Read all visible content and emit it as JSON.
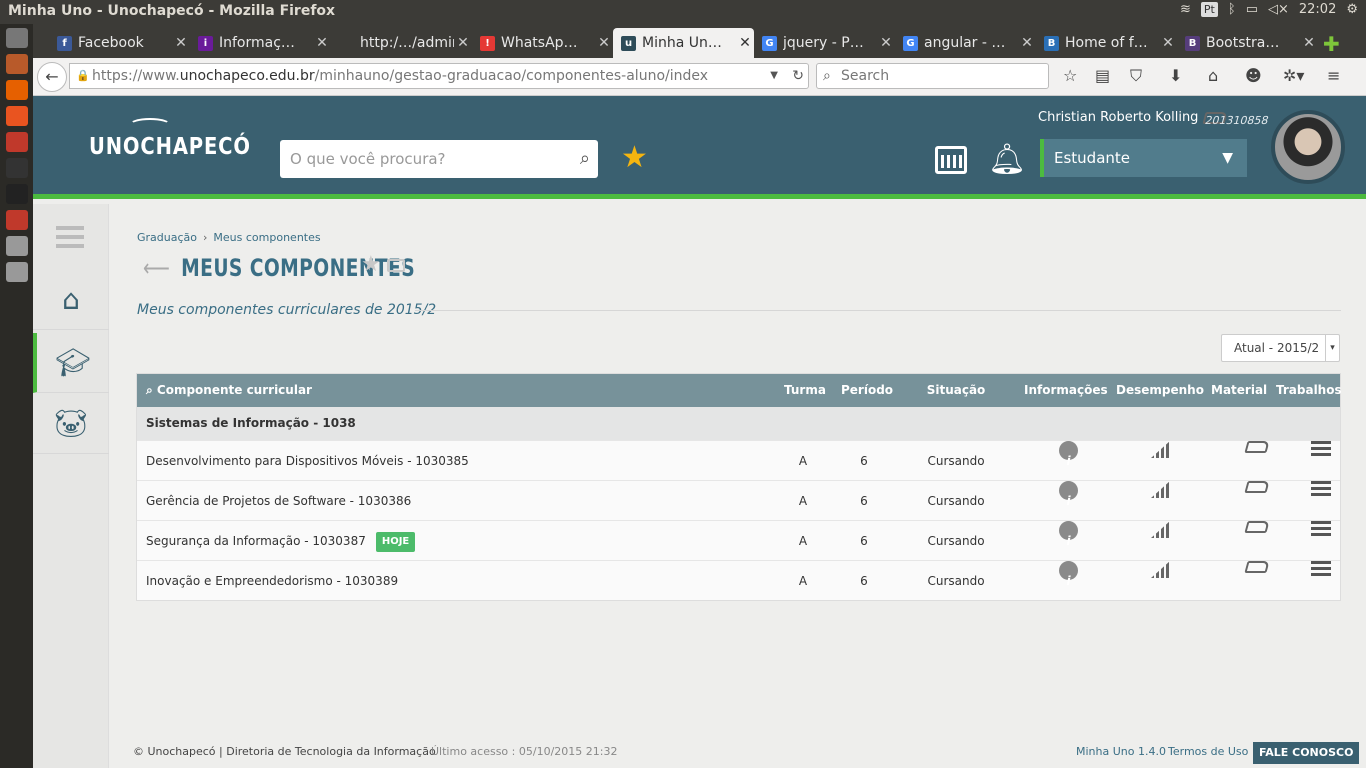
{
  "window": {
    "title": "Minha Uno - Unochapecó - Mozilla Firefox",
    "lang": "Pt",
    "time": "22:02"
  },
  "tabs": [
    {
      "label": "Facebook",
      "color": "#3b5998",
      "glyph": "f"
    },
    {
      "label": "Informaç…",
      "color": "#6a1b9a",
      "glyph": "i"
    },
    {
      "label": "http:/…/admin",
      "color": "",
      "glyph": ""
    },
    {
      "label": "WhatsAp…",
      "color": "#e53935",
      "glyph": "!"
    },
    {
      "label": "Minha Un…",
      "color": "#2e4c59",
      "glyph": "u"
    },
    {
      "label": "jquery - P…",
      "color": "#4285f4",
      "glyph": "G"
    },
    {
      "label": "angular - …",
      "color": "#4285f4",
      "glyph": "G"
    },
    {
      "label": "Home of f…",
      "color": "#2a6fb6",
      "glyph": "B"
    },
    {
      "label": "Bootstra…",
      "color": "#563d7c",
      "glyph": "B"
    }
  ],
  "nav": {
    "url_prefix": "https://www.",
    "url_domain": "unochapeco.edu.br",
    "url_path": "/minhauno/gestao-graduacao/componentes-aluno/index",
    "search_placeholder": "Search"
  },
  "header": {
    "logo": "UNOCHAPECÓ",
    "search_placeholder": "O que você procura?",
    "user_name": "Christian Roberto Kolling",
    "user_id": "201310858",
    "role": "Estudante"
  },
  "breadcrumb": {
    "root": "Graduação",
    "current": "Meus componentes"
  },
  "page": {
    "title": "MEUS COMPONENTES",
    "subtitle": "Meus componentes curriculares de 2015/2",
    "period": "Atual - 2015/2"
  },
  "table": {
    "headers": {
      "componente": "Componente curricular",
      "turma": "Turma",
      "periodo": "Período",
      "situacao": "Situação",
      "info": "Informações",
      "desempenho": "Desempenho",
      "material": "Material",
      "trabalhos": "Trabalhos"
    },
    "group": "Sistemas de Informação - 1038",
    "rows": [
      {
        "name": "Desenvolvimento para Dispositivos Móveis - 1030385",
        "turma": "A",
        "periodo": "6",
        "situacao": "Cursando",
        "badge": ""
      },
      {
        "name": "Gerência de Projetos de Software - 1030386",
        "turma": "A",
        "periodo": "6",
        "situacao": "Cursando",
        "badge": ""
      },
      {
        "name": "Segurança da Informação - 1030387",
        "turma": "A",
        "periodo": "6",
        "situacao": "Cursando",
        "badge": "HOJE"
      },
      {
        "name": "Inovação e Empreendedorismo - 1030389",
        "turma": "A",
        "periodo": "6",
        "situacao": "Cursando",
        "badge": ""
      }
    ]
  },
  "footer": {
    "copyright": "© Unochapecó | Diretoria de Tecnologia da Informação",
    "last_access": "Último acesso : 05/10/2015 21:32",
    "version": "Minha Uno 1.4.0",
    "terms": "Termos de Uso",
    "contact": "FALE CONOSCO"
  }
}
